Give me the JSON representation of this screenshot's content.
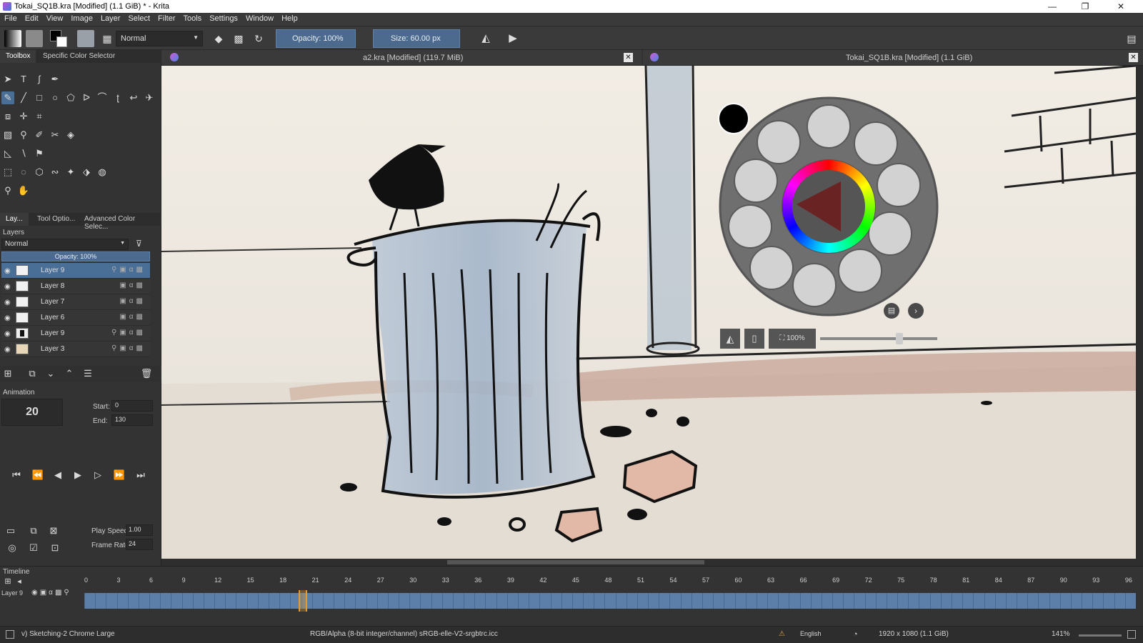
{
  "window": {
    "title": "Tokai_SQ1B.kra [Modified]  (1.1 GiB) * - Krita"
  },
  "menu": [
    "File",
    "Edit",
    "View",
    "Image",
    "Layer",
    "Select",
    "Filter",
    "Tools",
    "Settings",
    "Window",
    "Help"
  ],
  "toolbar": {
    "blend_mode": "Normal",
    "opacity": "Opacity:  100%",
    "size": "Size:  60.00 px"
  },
  "left_tabs_top": [
    "Toolbox",
    "Specific Color Selector"
  ],
  "left_tabs_mid": [
    "Lay...",
    "Tool Optio...",
    "Advanced Color Selec..."
  ],
  "layers": {
    "title": "Layers",
    "blend_mode": "Normal",
    "opacity": "Opacity:  100%",
    "items": [
      "Layer 9",
      "Layer 8",
      "Layer 7",
      "Layer 6",
      "Layer 9",
      "Layer 3"
    ]
  },
  "animation": {
    "title": "Animation",
    "current_frame": "20",
    "start_label": "Start:",
    "start_value": "0",
    "end_label": "End:",
    "end_value": "130",
    "play_speed_label": "Play Speed:",
    "play_speed_value": "1.00",
    "frame_rate_label": "Frame Rate:",
    "frame_rate_value": "24"
  },
  "documents": [
    {
      "title": "a2.kra [Modified]  (119.7 MiB)"
    },
    {
      "title": "Tokai_SQ1B.kra [Modified]  (1.1 GiB)"
    }
  ],
  "popup_palette": {
    "zoom": "100%"
  },
  "timeline": {
    "title": "Timeline",
    "layer": "Layer 9",
    "ruler": [
      "0",
      "3",
      "6",
      "9",
      "12",
      "15",
      "18",
      "21",
      "24",
      "27",
      "30",
      "33",
      "36",
      "39",
      "42",
      "45",
      "48",
      "51",
      "54",
      "57",
      "60",
      "63",
      "66",
      "69",
      "72",
      "75",
      "78",
      "81",
      "84",
      "87",
      "90",
      "93",
      "96"
    ],
    "current_frame": 20
  },
  "status": {
    "brush": "v) Sketching-2 Chrome Large",
    "color_space": "RGB/Alpha (8-bit integer/channel)  sRGB-elle-V2-srgbtrc.icc",
    "language": "English",
    "dimensions": "1920 x 1080 (1.1 GiB)",
    "zoom": "141%"
  }
}
